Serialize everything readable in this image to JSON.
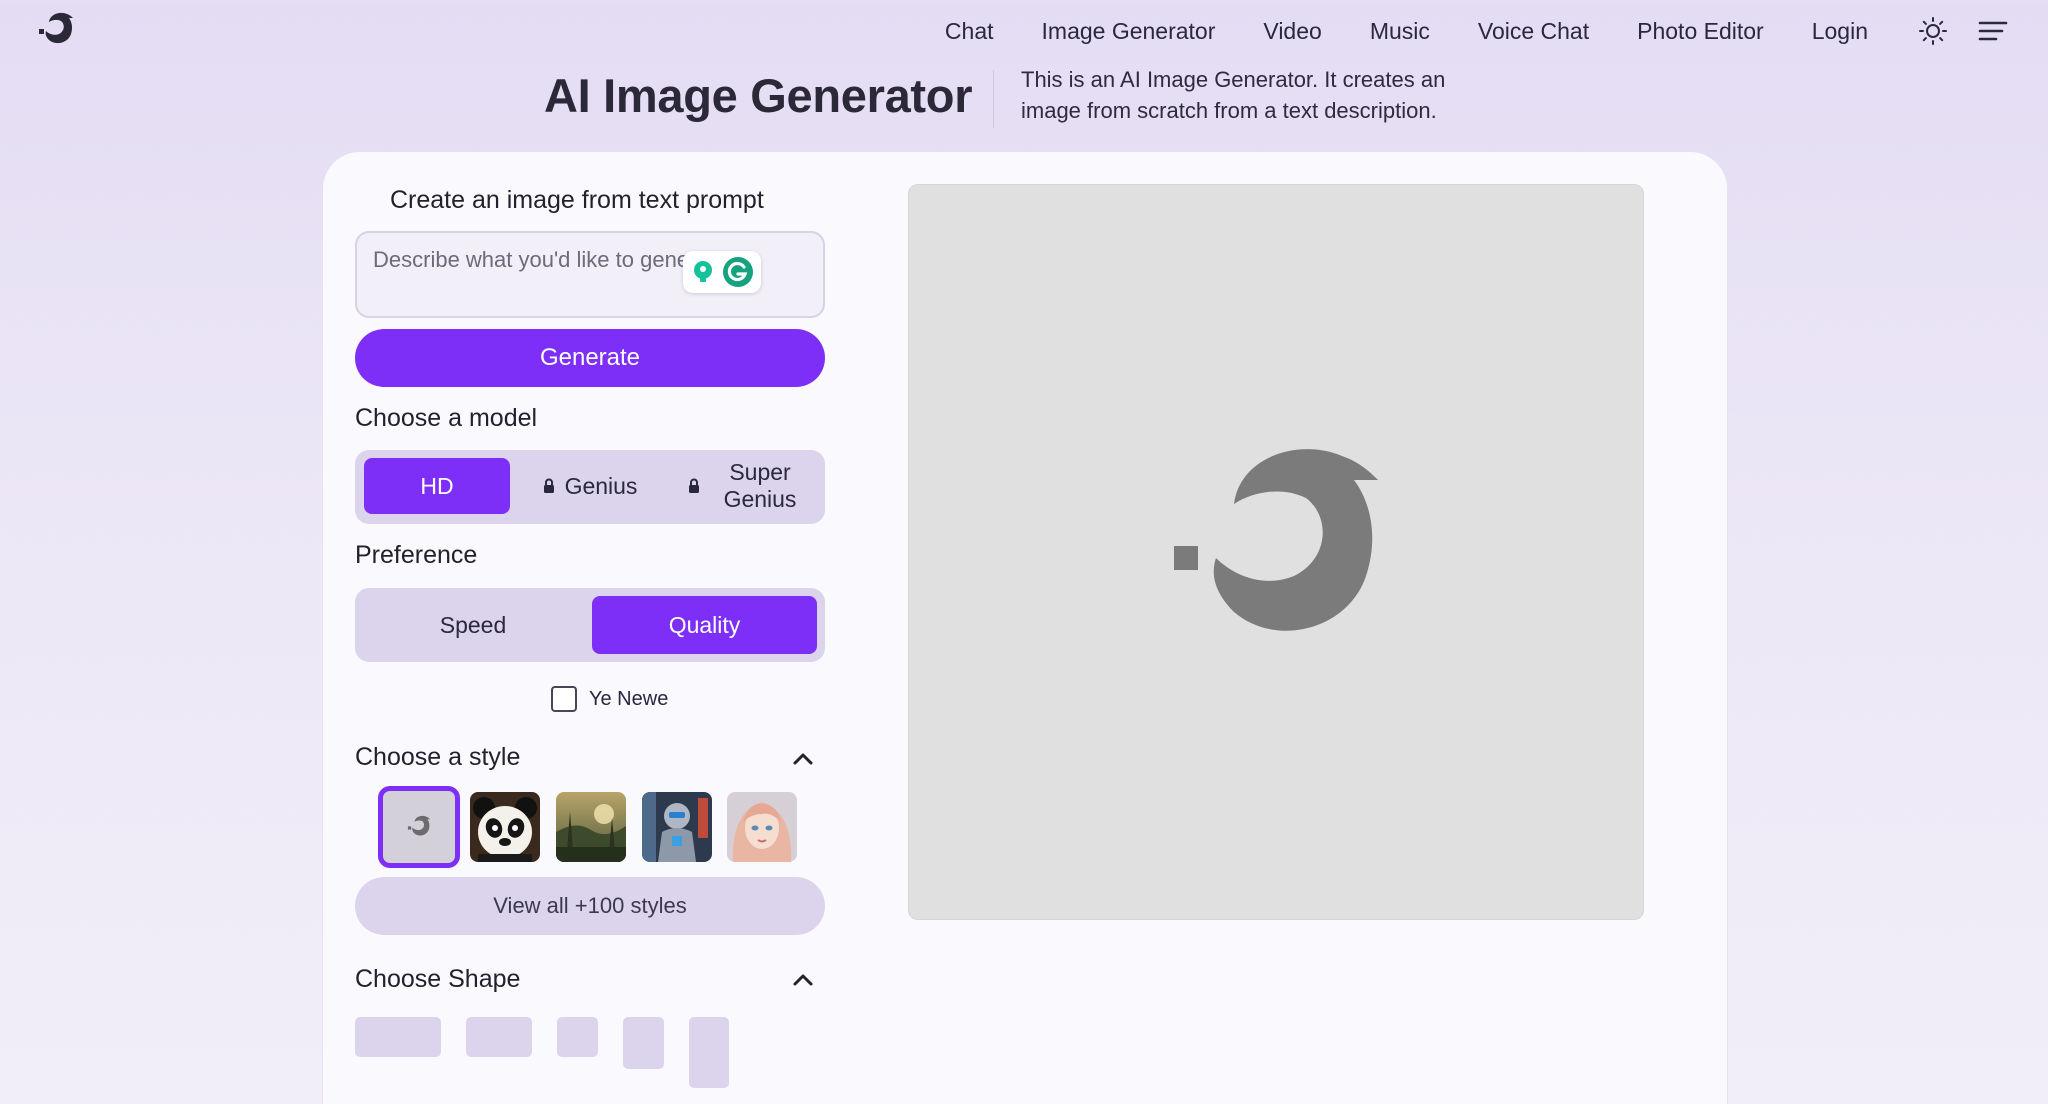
{
  "nav": {
    "links": [
      "Chat",
      "Image Generator",
      "Video",
      "Music",
      "Voice Chat",
      "Photo Editor",
      "Login"
    ],
    "theme_icon": "sun-icon",
    "menu_icon": "hamburger-menu-icon"
  },
  "header": {
    "title": "AI Image Generator",
    "description": "This is an AI Image Generator. It creates an image from scratch from a text description."
  },
  "prompt": {
    "heading": "Create an image from text prompt",
    "placeholder": "Describe what you'd like to generate",
    "value": ""
  },
  "generate_label": "Generate",
  "model": {
    "heading": "Choose a model",
    "options": [
      "HD",
      "Genius",
      "Super Genius"
    ],
    "selected": "HD",
    "locked": [
      "Genius",
      "Super Genius"
    ]
  },
  "preference": {
    "heading": "Preference",
    "options": [
      "Speed",
      "Quality"
    ],
    "selected": "Quality"
  },
  "ye_newe": {
    "label": "Ye Newe",
    "checked": false
  },
  "style": {
    "heading": "Choose a style",
    "thumbnails": [
      "default-style",
      "panda-style",
      "landscape-style",
      "robot-style",
      "portrait-style"
    ],
    "selected": "default-style",
    "view_all_label": "View all +100 styles"
  },
  "shape": {
    "heading": "Choose Shape"
  },
  "colors": {
    "accent": "#7d2ff7",
    "segment_bg": "#dcd4ec",
    "page_bg": "#e9e4f5",
    "preview_bg": "#e0e0e0"
  }
}
